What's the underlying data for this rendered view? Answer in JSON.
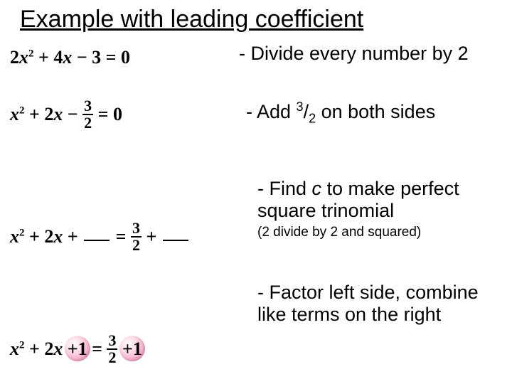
{
  "title": "Example with leading coefficient",
  "steps": {
    "s1": "- Divide every number by 2",
    "s2_pre": "- Add ",
    "s2_num": "3",
    "s2_sep": "/",
    "s2_den": "2",
    "s2_post": " on both sides",
    "s3a": "- Find ",
    "s3_c": "c",
    "s3b": " to make perfect",
    "s3c": "square trinomial",
    "s3_note": "(2 divide by 2 and squared)",
    "s4a": "- Factor left side, combine",
    "s4b": "like terms on the right"
  },
  "eq1": {
    "a": "2",
    "x": "x",
    "sq": "2",
    "p": "+",
    "b": "4",
    "x2": "x",
    "m": "−",
    "c": "3",
    "e": "=",
    "z": "0"
  },
  "eq2": {
    "x": "x",
    "sq": "2",
    "p": "+",
    "b": "2",
    "x2": "x",
    "m": "−",
    "fn": "3",
    "fd": "2",
    "e": "=",
    "z": "0"
  },
  "eq3": {
    "x": "x",
    "sq": "2",
    "p": "+",
    "b": "2",
    "x2": "x",
    "p2": "+",
    "e": "=",
    "fn": "3",
    "fd": "2",
    "p3": "+"
  },
  "eq4": {
    "x": "x",
    "sq": "2",
    "p": "+",
    "b": "2",
    "x2": "x",
    "p2": "+",
    "c1": "1",
    "e": "=",
    "fn": "3",
    "fd": "2",
    "p3": "+",
    "c2": "1"
  }
}
